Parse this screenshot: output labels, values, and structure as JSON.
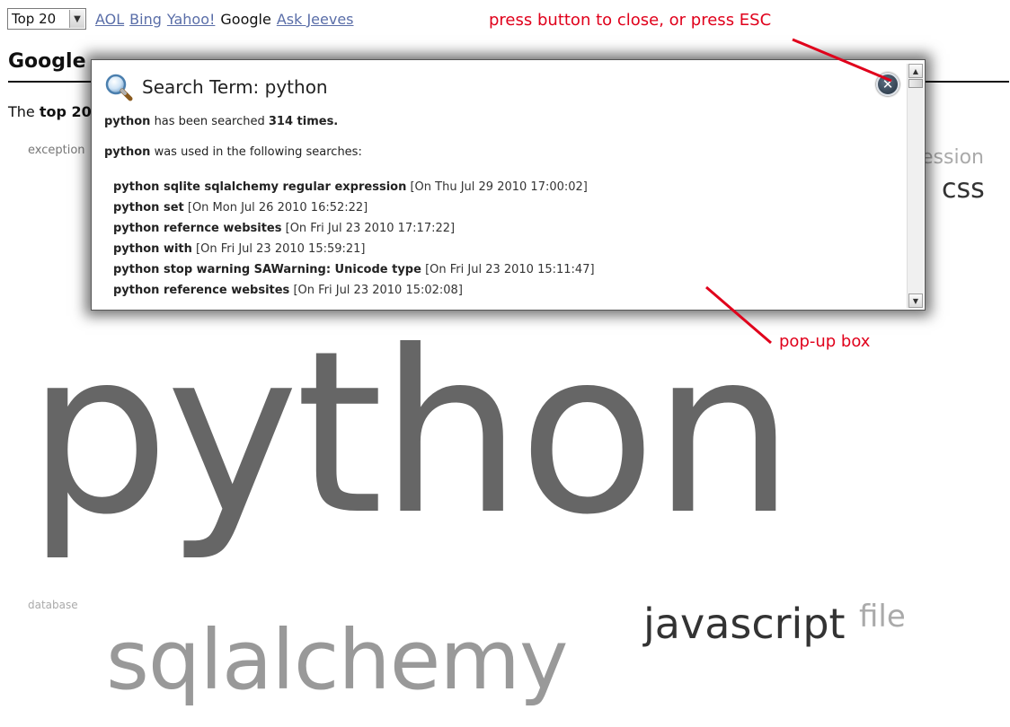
{
  "topbar": {
    "select_value": "Top 20",
    "engines": [
      {
        "label": "AOL",
        "link": true
      },
      {
        "label": "Bing",
        "link": true
      },
      {
        "label": "Yahoo!",
        "link": true
      },
      {
        "label": "Google",
        "link": false
      },
      {
        "label": "Ask Jeeves",
        "link": true
      }
    ]
  },
  "page": {
    "title": "Google",
    "intro_prefix": "The ",
    "intro_bold": "top 20"
  },
  "cloud": {
    "exception": "exception",
    "expression": "ession",
    "css": "css",
    "python": "python",
    "database": "database",
    "sqlalchemy": "sqlalchemy",
    "javascript": "javascript",
    "file": "file"
  },
  "popup": {
    "title": "Search Term: python",
    "term": "python",
    "count_mid": " has been searched ",
    "count_value": "314 times.",
    "used_tail": " was used in the following searches:",
    "searches": [
      {
        "query": "python sqlite sqlalchemy regular expression",
        "date": "[On Thu Jul 29 2010 17:00:02]"
      },
      {
        "query": "python set",
        "date": "[On Mon Jul 26 2010 16:52:22]"
      },
      {
        "query": "python refernce websites",
        "date": "[On Fri Jul 23 2010 17:17:22]"
      },
      {
        "query": "python with",
        "date": "[On Fri Jul 23 2010 15:59:21]"
      },
      {
        "query": "python stop warning SAWarning: Unicode type",
        "date": "[On Fri Jul 23 2010 15:11:47]"
      },
      {
        "query": "python reference websites",
        "date": "[On Fri Jul 23 2010 15:02:08]"
      }
    ],
    "close_glyph": "✕"
  },
  "annotations": {
    "close_hint": "press button to close, or press ESC",
    "popup_label": "pop-up box"
  },
  "colors": {
    "annotation": "#e0001b",
    "link": "#5a6ea8"
  }
}
